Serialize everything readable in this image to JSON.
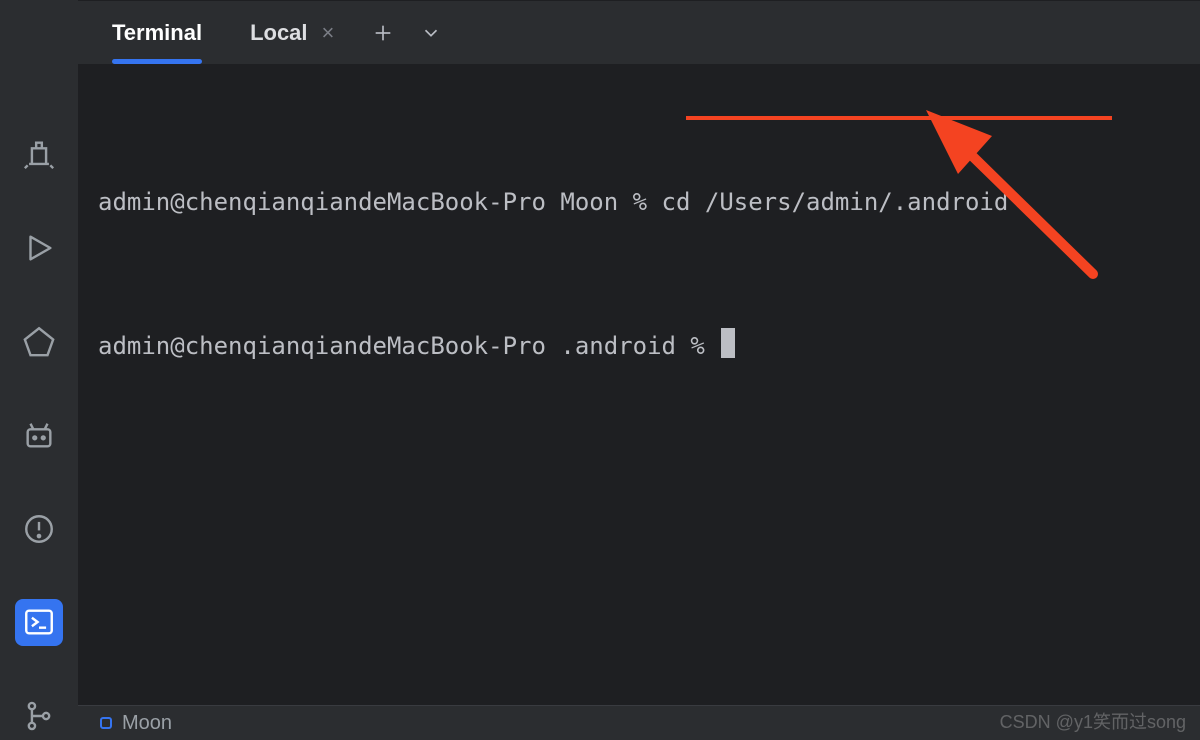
{
  "tabs": {
    "active": {
      "label": "Terminal"
    },
    "second": {
      "label": "Local"
    }
  },
  "terminal": {
    "line1_prompt": "admin@chenqianqiandeMacBook-Pro Moon % ",
    "line1_cmd": "cd /Users/admin/.android",
    "line2_prompt": "admin@chenqianqiandeMacBook-Pro .android % "
  },
  "statusbar": {
    "project": "Moon"
  },
  "watermark": "CSDN @y1笑而过song",
  "annotation_color": "#f44321"
}
